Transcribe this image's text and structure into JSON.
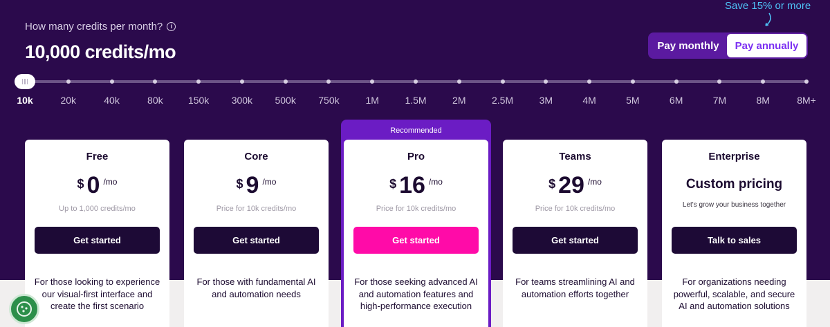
{
  "header": {
    "question": "How many credits per month?",
    "credits_value": "10,000 credits/mo",
    "save_note": "Save 15% or more"
  },
  "billing_toggle": {
    "monthly_label": "Pay monthly",
    "annual_label": "Pay annually",
    "selected": "Pay annually"
  },
  "slider": {
    "selected": "10k",
    "ticks": [
      "10k",
      "20k",
      "40k",
      "80k",
      "150k",
      "300k",
      "500k",
      "750k",
      "1M",
      "1.5M",
      "2M",
      "2.5M",
      "3M",
      "4M",
      "5M",
      "6M",
      "7M",
      "8M",
      "8M+"
    ]
  },
  "plans": [
    {
      "name": "Free",
      "currency": "$",
      "amount": "0",
      "unit": "/mo",
      "note": "Up to 1,000 credits/mo",
      "cta": "Get started",
      "desc": "For those looking to experience our visual-first interface and create the first scenario"
    },
    {
      "name": "Core",
      "currency": "$",
      "amount": "9",
      "unit": "/mo",
      "note": "Price for 10k credits/mo",
      "cta": "Get started",
      "desc": "For those with fundamental AI and automation needs"
    },
    {
      "name": "Pro",
      "badge": "Recommended",
      "currency": "$",
      "amount": "16",
      "unit": "/mo",
      "note": "Price for 10k credits/mo",
      "cta": "Get started",
      "desc": "For those seeking advanced AI and automation features and high-performance execution"
    },
    {
      "name": "Teams",
      "currency": "$",
      "amount": "29",
      "unit": "/mo",
      "note": "Price for 10k credits/mo",
      "cta": "Get started",
      "desc": "For teams streamlining AI and automation efforts together"
    },
    {
      "name": "Enterprise",
      "custom_price": "Custom pricing",
      "note": "Let's grow your business together",
      "cta": "Talk to sales",
      "desc": "For organizations needing powerful, scalable, and secure AI and automation solutions"
    }
  ],
  "colors": {
    "background": "#2b0a4c",
    "accent_purple": "#7b2ff2",
    "cta_dark": "#1d0a36",
    "cta_pink": "#ff0ba8",
    "save_note": "#4fc3f7"
  }
}
